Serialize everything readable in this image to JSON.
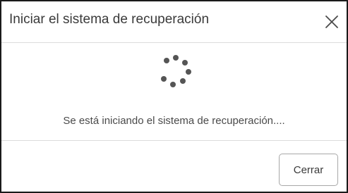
{
  "dialog": {
    "title": "Iniciar el sistema de recuperación",
    "status_message": "Se está iniciando el sistema de recuperación....",
    "close_label": "Cerrar"
  },
  "icons": {
    "close": "close-icon",
    "spinner": "loading-spinner-icon"
  },
  "colors": {
    "border": "#1a1a1a",
    "divider": "#dcdcdc",
    "text": "#3a3a3a",
    "spinner_dot": "#555555"
  }
}
